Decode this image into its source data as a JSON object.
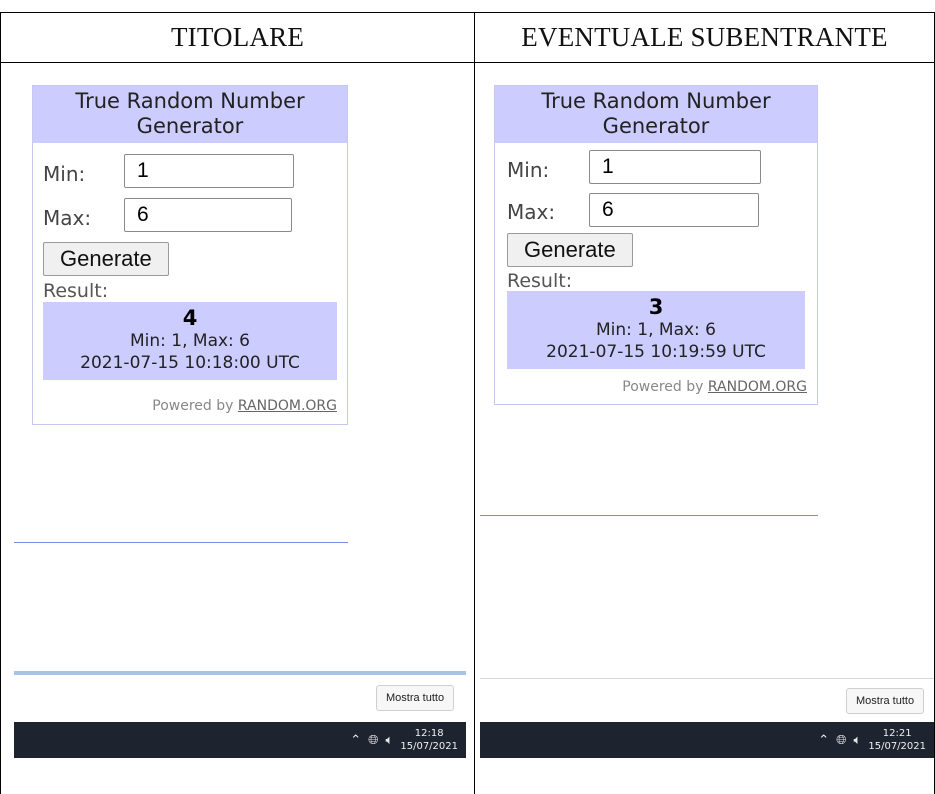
{
  "columns": {
    "left_header": "TITOLARE",
    "right_header": "EVENTUALE SUBENTRANTE"
  },
  "left": {
    "widget": {
      "title": "True Random Number Generator",
      "min_label": "Min:",
      "min_value": "1",
      "max_label": "Max:",
      "max_value": "6",
      "generate_label": "Generate",
      "result_label": "Result:",
      "result_number": "4",
      "result_range": "Min: 1, Max: 6",
      "result_timestamp": "2021-07-15 10:18:00 UTC",
      "powered_prefix": "Powered by",
      "powered_link": "RANDOM.ORG"
    },
    "show_all": "Mostra tutto",
    "taskbar": {
      "time": "12:18",
      "date": "15/07/2021",
      "chevron_icon": "chevron-up-icon",
      "network_icon": "globe-network-icon",
      "volume_icon": "speaker-icon"
    }
  },
  "right": {
    "widget": {
      "title": "True Random Number Generator",
      "min_label": "Min:",
      "min_value": "1",
      "max_label": "Max:",
      "max_value": "6",
      "generate_label": "Generate",
      "result_label": "Result:",
      "result_number": "3",
      "result_range": "Min: 1, Max: 6",
      "result_timestamp": "2021-07-15 10:19:59 UTC",
      "powered_prefix": "Powered by",
      "powered_link": "RANDOM.ORG"
    },
    "show_all": "Mostra tutto",
    "taskbar": {
      "time": "12:21",
      "date": "15/07/2021",
      "chevron_icon": "chevron-up-icon",
      "network_icon": "globe-network-icon",
      "volume_icon": "speaker-icon"
    }
  },
  "colors": {
    "widget_header_bg": "#ccccff",
    "result_bg": "#ccccff",
    "taskbar_bg": "#1e2330",
    "accent_line": "#7a8be0"
  }
}
